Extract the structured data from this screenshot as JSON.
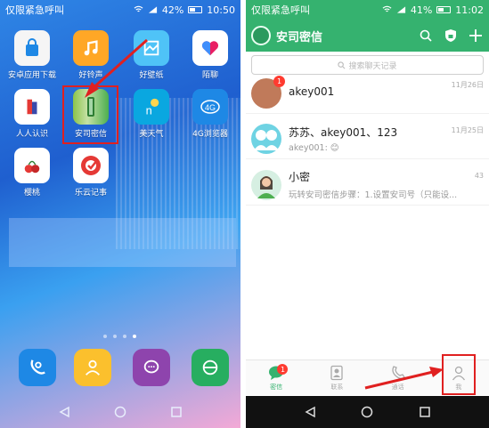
{
  "left_phone": {
    "status": {
      "carrier": "仅限紧急呼叫",
      "battery": "42%",
      "time": "10:50"
    },
    "apps": [
      {
        "label": "安卓应用下载",
        "icon": "bag-icon",
        "color": "#ffffff"
      },
      {
        "label": "好铃声",
        "icon": "music-note-icon",
        "color": "#ffa726"
      },
      {
        "label": "好壁纸",
        "icon": "wallpaper-icon",
        "color": "#29b6f6"
      },
      {
        "label": "陌聊",
        "icon": "heart-icon",
        "color": "#ffffff"
      },
      {
        "label": "人人认识",
        "icon": "people-icon",
        "color": "#ffffff"
      },
      {
        "label": "安司密信",
        "icon": "secret-app-icon",
        "color": "#4caf50"
      },
      {
        "label": "美天气",
        "icon": "weather-icon",
        "color": "#29b6f6"
      },
      {
        "label": "4G浏览器",
        "icon": "browser-4g-icon",
        "color": "#29b6f6"
      },
      {
        "label": "樱桃",
        "icon": "cherry-icon",
        "color": "#ffffff"
      },
      {
        "label": "乐云记事",
        "icon": "note-icon",
        "color": "#e53935"
      }
    ],
    "dock": [
      {
        "label": "",
        "icon": "phone-icon",
        "color": "#1e88e5"
      },
      {
        "label": "",
        "icon": "contacts-icon",
        "color": "#fbc02d"
      },
      {
        "label": "",
        "icon": "messages-icon",
        "color": "#8e44ad"
      },
      {
        "label": "",
        "icon": "browser-icon",
        "color": "#27ae60"
      }
    ]
  },
  "right_phone": {
    "status": {
      "carrier": "仅限紧急呼叫",
      "battery": "41%",
      "time": "11:02"
    },
    "header": {
      "title": "安司密信"
    },
    "search": {
      "placeholder": "搜索聊天记录"
    },
    "conversations": [
      {
        "name": "akey001",
        "preview": "",
        "time": "11月26日",
        "badge": "1",
        "avatar_color": "#c07a5a"
      },
      {
        "name": "苏苏、akey001、123",
        "preview": "akey001: 😊",
        "time": "11月25日",
        "badge": "",
        "avatar_color": "#6fd3e3"
      },
      {
        "name": "小密",
        "preview": "玩转安司密信步骤：1.设置安司号（只能设...",
        "time": "43",
        "badge": "",
        "avatar_color": "#d6efe2"
      }
    ],
    "tabs": [
      {
        "label": "密信",
        "badge": "1",
        "active": true
      },
      {
        "label": "联系",
        "badge": "",
        "active": false
      },
      {
        "label": "通话",
        "badge": "",
        "active": false
      },
      {
        "label": "我",
        "badge": "",
        "active": false
      }
    ]
  }
}
